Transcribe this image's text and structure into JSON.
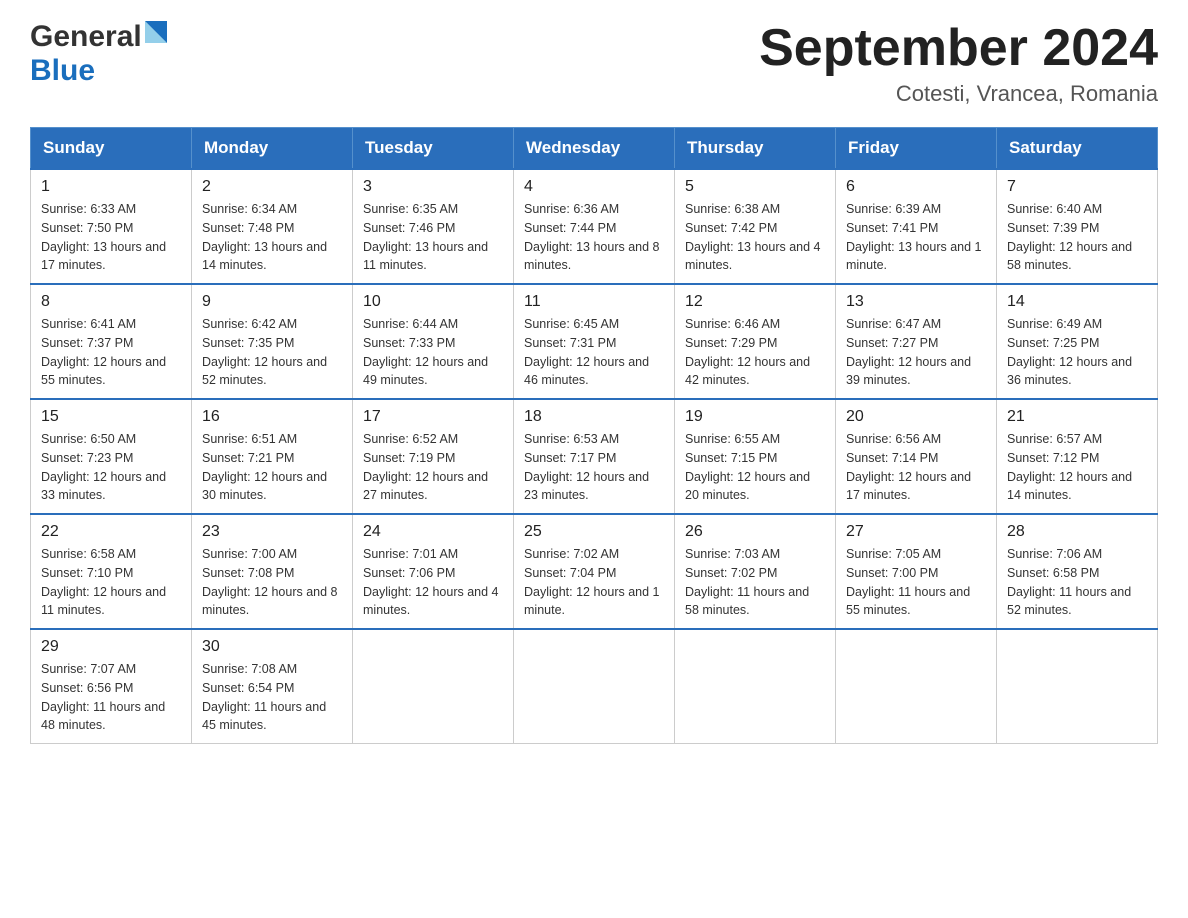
{
  "header": {
    "logo_general": "General",
    "logo_blue": "Blue",
    "month_title": "September 2024",
    "location": "Cotesti, Vrancea, Romania"
  },
  "days_of_week": [
    "Sunday",
    "Monday",
    "Tuesday",
    "Wednesday",
    "Thursday",
    "Friday",
    "Saturday"
  ],
  "weeks": [
    [
      {
        "day": "1",
        "sunrise": "Sunrise: 6:33 AM",
        "sunset": "Sunset: 7:50 PM",
        "daylight": "Daylight: 13 hours and 17 minutes."
      },
      {
        "day": "2",
        "sunrise": "Sunrise: 6:34 AM",
        "sunset": "Sunset: 7:48 PM",
        "daylight": "Daylight: 13 hours and 14 minutes."
      },
      {
        "day": "3",
        "sunrise": "Sunrise: 6:35 AM",
        "sunset": "Sunset: 7:46 PM",
        "daylight": "Daylight: 13 hours and 11 minutes."
      },
      {
        "day": "4",
        "sunrise": "Sunrise: 6:36 AM",
        "sunset": "Sunset: 7:44 PM",
        "daylight": "Daylight: 13 hours and 8 minutes."
      },
      {
        "day": "5",
        "sunrise": "Sunrise: 6:38 AM",
        "sunset": "Sunset: 7:42 PM",
        "daylight": "Daylight: 13 hours and 4 minutes."
      },
      {
        "day": "6",
        "sunrise": "Sunrise: 6:39 AM",
        "sunset": "Sunset: 7:41 PM",
        "daylight": "Daylight: 13 hours and 1 minute."
      },
      {
        "day": "7",
        "sunrise": "Sunrise: 6:40 AM",
        "sunset": "Sunset: 7:39 PM",
        "daylight": "Daylight: 12 hours and 58 minutes."
      }
    ],
    [
      {
        "day": "8",
        "sunrise": "Sunrise: 6:41 AM",
        "sunset": "Sunset: 7:37 PM",
        "daylight": "Daylight: 12 hours and 55 minutes."
      },
      {
        "day": "9",
        "sunrise": "Sunrise: 6:42 AM",
        "sunset": "Sunset: 7:35 PM",
        "daylight": "Daylight: 12 hours and 52 minutes."
      },
      {
        "day": "10",
        "sunrise": "Sunrise: 6:44 AM",
        "sunset": "Sunset: 7:33 PM",
        "daylight": "Daylight: 12 hours and 49 minutes."
      },
      {
        "day": "11",
        "sunrise": "Sunrise: 6:45 AM",
        "sunset": "Sunset: 7:31 PM",
        "daylight": "Daylight: 12 hours and 46 minutes."
      },
      {
        "day": "12",
        "sunrise": "Sunrise: 6:46 AM",
        "sunset": "Sunset: 7:29 PM",
        "daylight": "Daylight: 12 hours and 42 minutes."
      },
      {
        "day": "13",
        "sunrise": "Sunrise: 6:47 AM",
        "sunset": "Sunset: 7:27 PM",
        "daylight": "Daylight: 12 hours and 39 minutes."
      },
      {
        "day": "14",
        "sunrise": "Sunrise: 6:49 AM",
        "sunset": "Sunset: 7:25 PM",
        "daylight": "Daylight: 12 hours and 36 minutes."
      }
    ],
    [
      {
        "day": "15",
        "sunrise": "Sunrise: 6:50 AM",
        "sunset": "Sunset: 7:23 PM",
        "daylight": "Daylight: 12 hours and 33 minutes."
      },
      {
        "day": "16",
        "sunrise": "Sunrise: 6:51 AM",
        "sunset": "Sunset: 7:21 PM",
        "daylight": "Daylight: 12 hours and 30 minutes."
      },
      {
        "day": "17",
        "sunrise": "Sunrise: 6:52 AM",
        "sunset": "Sunset: 7:19 PM",
        "daylight": "Daylight: 12 hours and 27 minutes."
      },
      {
        "day": "18",
        "sunrise": "Sunrise: 6:53 AM",
        "sunset": "Sunset: 7:17 PM",
        "daylight": "Daylight: 12 hours and 23 minutes."
      },
      {
        "day": "19",
        "sunrise": "Sunrise: 6:55 AM",
        "sunset": "Sunset: 7:15 PM",
        "daylight": "Daylight: 12 hours and 20 minutes."
      },
      {
        "day": "20",
        "sunrise": "Sunrise: 6:56 AM",
        "sunset": "Sunset: 7:14 PM",
        "daylight": "Daylight: 12 hours and 17 minutes."
      },
      {
        "day": "21",
        "sunrise": "Sunrise: 6:57 AM",
        "sunset": "Sunset: 7:12 PM",
        "daylight": "Daylight: 12 hours and 14 minutes."
      }
    ],
    [
      {
        "day": "22",
        "sunrise": "Sunrise: 6:58 AM",
        "sunset": "Sunset: 7:10 PM",
        "daylight": "Daylight: 12 hours and 11 minutes."
      },
      {
        "day": "23",
        "sunrise": "Sunrise: 7:00 AM",
        "sunset": "Sunset: 7:08 PM",
        "daylight": "Daylight: 12 hours and 8 minutes."
      },
      {
        "day": "24",
        "sunrise": "Sunrise: 7:01 AM",
        "sunset": "Sunset: 7:06 PM",
        "daylight": "Daylight: 12 hours and 4 minutes."
      },
      {
        "day": "25",
        "sunrise": "Sunrise: 7:02 AM",
        "sunset": "Sunset: 7:04 PM",
        "daylight": "Daylight: 12 hours and 1 minute."
      },
      {
        "day": "26",
        "sunrise": "Sunrise: 7:03 AM",
        "sunset": "Sunset: 7:02 PM",
        "daylight": "Daylight: 11 hours and 58 minutes."
      },
      {
        "day": "27",
        "sunrise": "Sunrise: 7:05 AM",
        "sunset": "Sunset: 7:00 PM",
        "daylight": "Daylight: 11 hours and 55 minutes."
      },
      {
        "day": "28",
        "sunrise": "Sunrise: 7:06 AM",
        "sunset": "Sunset: 6:58 PM",
        "daylight": "Daylight: 11 hours and 52 minutes."
      }
    ],
    [
      {
        "day": "29",
        "sunrise": "Sunrise: 7:07 AM",
        "sunset": "Sunset: 6:56 PM",
        "daylight": "Daylight: 11 hours and 48 minutes."
      },
      {
        "day": "30",
        "sunrise": "Sunrise: 7:08 AM",
        "sunset": "Sunset: 6:54 PM",
        "daylight": "Daylight: 11 hours and 45 minutes."
      },
      {
        "day": "",
        "sunrise": "",
        "sunset": "",
        "daylight": ""
      },
      {
        "day": "",
        "sunrise": "",
        "sunset": "",
        "daylight": ""
      },
      {
        "day": "",
        "sunrise": "",
        "sunset": "",
        "daylight": ""
      },
      {
        "day": "",
        "sunrise": "",
        "sunset": "",
        "daylight": ""
      },
      {
        "day": "",
        "sunrise": "",
        "sunset": "",
        "daylight": ""
      }
    ]
  ]
}
